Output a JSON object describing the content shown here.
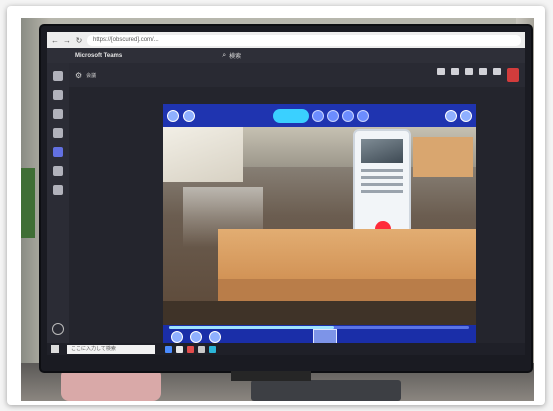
{
  "browser": {
    "url": "https://[obscured].com/...",
    "back_glyph": "←",
    "forward_glyph": "→",
    "refresh_glyph": "↻"
  },
  "app": {
    "title": "Microsoft Teams",
    "search_icon": "search-icon",
    "search_label": "検索"
  },
  "rail": {
    "items": [
      {
        "label": "",
        "icon": "activity-icon"
      },
      {
        "label": "",
        "icon": "chat-icon"
      },
      {
        "label": "",
        "icon": "teams-icon"
      },
      {
        "label": "",
        "icon": "calendar-icon"
      },
      {
        "label": "",
        "icon": "calls-icon",
        "active": true
      },
      {
        "label": "",
        "icon": "files-icon"
      },
      {
        "label": "",
        "icon": "apps-icon"
      }
    ]
  },
  "meeting": {
    "name": "会議",
    "actions": [
      {
        "label": "",
        "icon": "people-icon"
      },
      {
        "label": "",
        "icon": "chat-icon"
      },
      {
        "label": "",
        "icon": "reactions-icon"
      },
      {
        "label": "",
        "icon": "more-icon"
      },
      {
        "label": "",
        "icon": "mic-icon"
      }
    ],
    "leave_icon": "phone-hangup-icon"
  },
  "share": {
    "progress": 0.55,
    "colors": {
      "toolbar": "#1f34b0",
      "accent": "#3ad0ff",
      "record": "#ff2b3a"
    }
  },
  "taskbar": {
    "search_placeholder": "ここに入力して検索",
    "tray_text": ""
  }
}
